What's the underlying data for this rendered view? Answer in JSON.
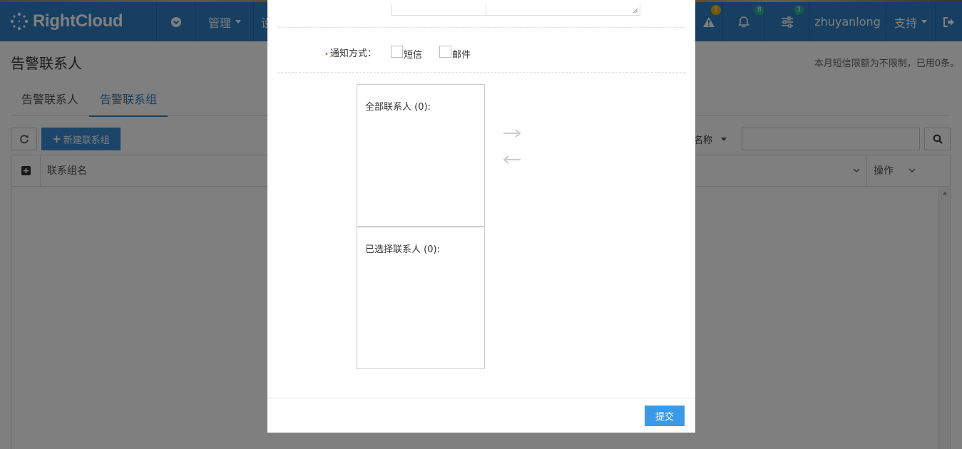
{
  "app": {
    "brand": "RightCloud"
  },
  "nav": {
    "manage": "管理",
    "settings_partial": "设",
    "alert_badge": "1",
    "bell_badge": "8",
    "config_badge": "3",
    "username": "zhuyanlong",
    "support": "支持"
  },
  "page": {
    "title": "告警联系人",
    "quota": "本月短信限额为不限制，已用0条。"
  },
  "tabs": [
    {
      "label": "告警联系人"
    },
    {
      "label": "告警联系组"
    }
  ],
  "toolbar": {
    "new_group": "新建联系组",
    "filter_label": "组名称"
  },
  "table": {
    "columns": [
      "联系组名",
      "操作"
    ]
  },
  "modal": {
    "notify_label": "通知方式：",
    "sms": "短信",
    "email": "邮件",
    "all_contacts": "全部联系人 (0):",
    "selected_contacts": "已选择联系人 (0):",
    "submit": "提交"
  },
  "colors": {
    "brand": "#2f7fc4",
    "badge_yellow": "#e6b400",
    "badge_teal": "#26b59a",
    "submit": "#3a9ae8"
  }
}
